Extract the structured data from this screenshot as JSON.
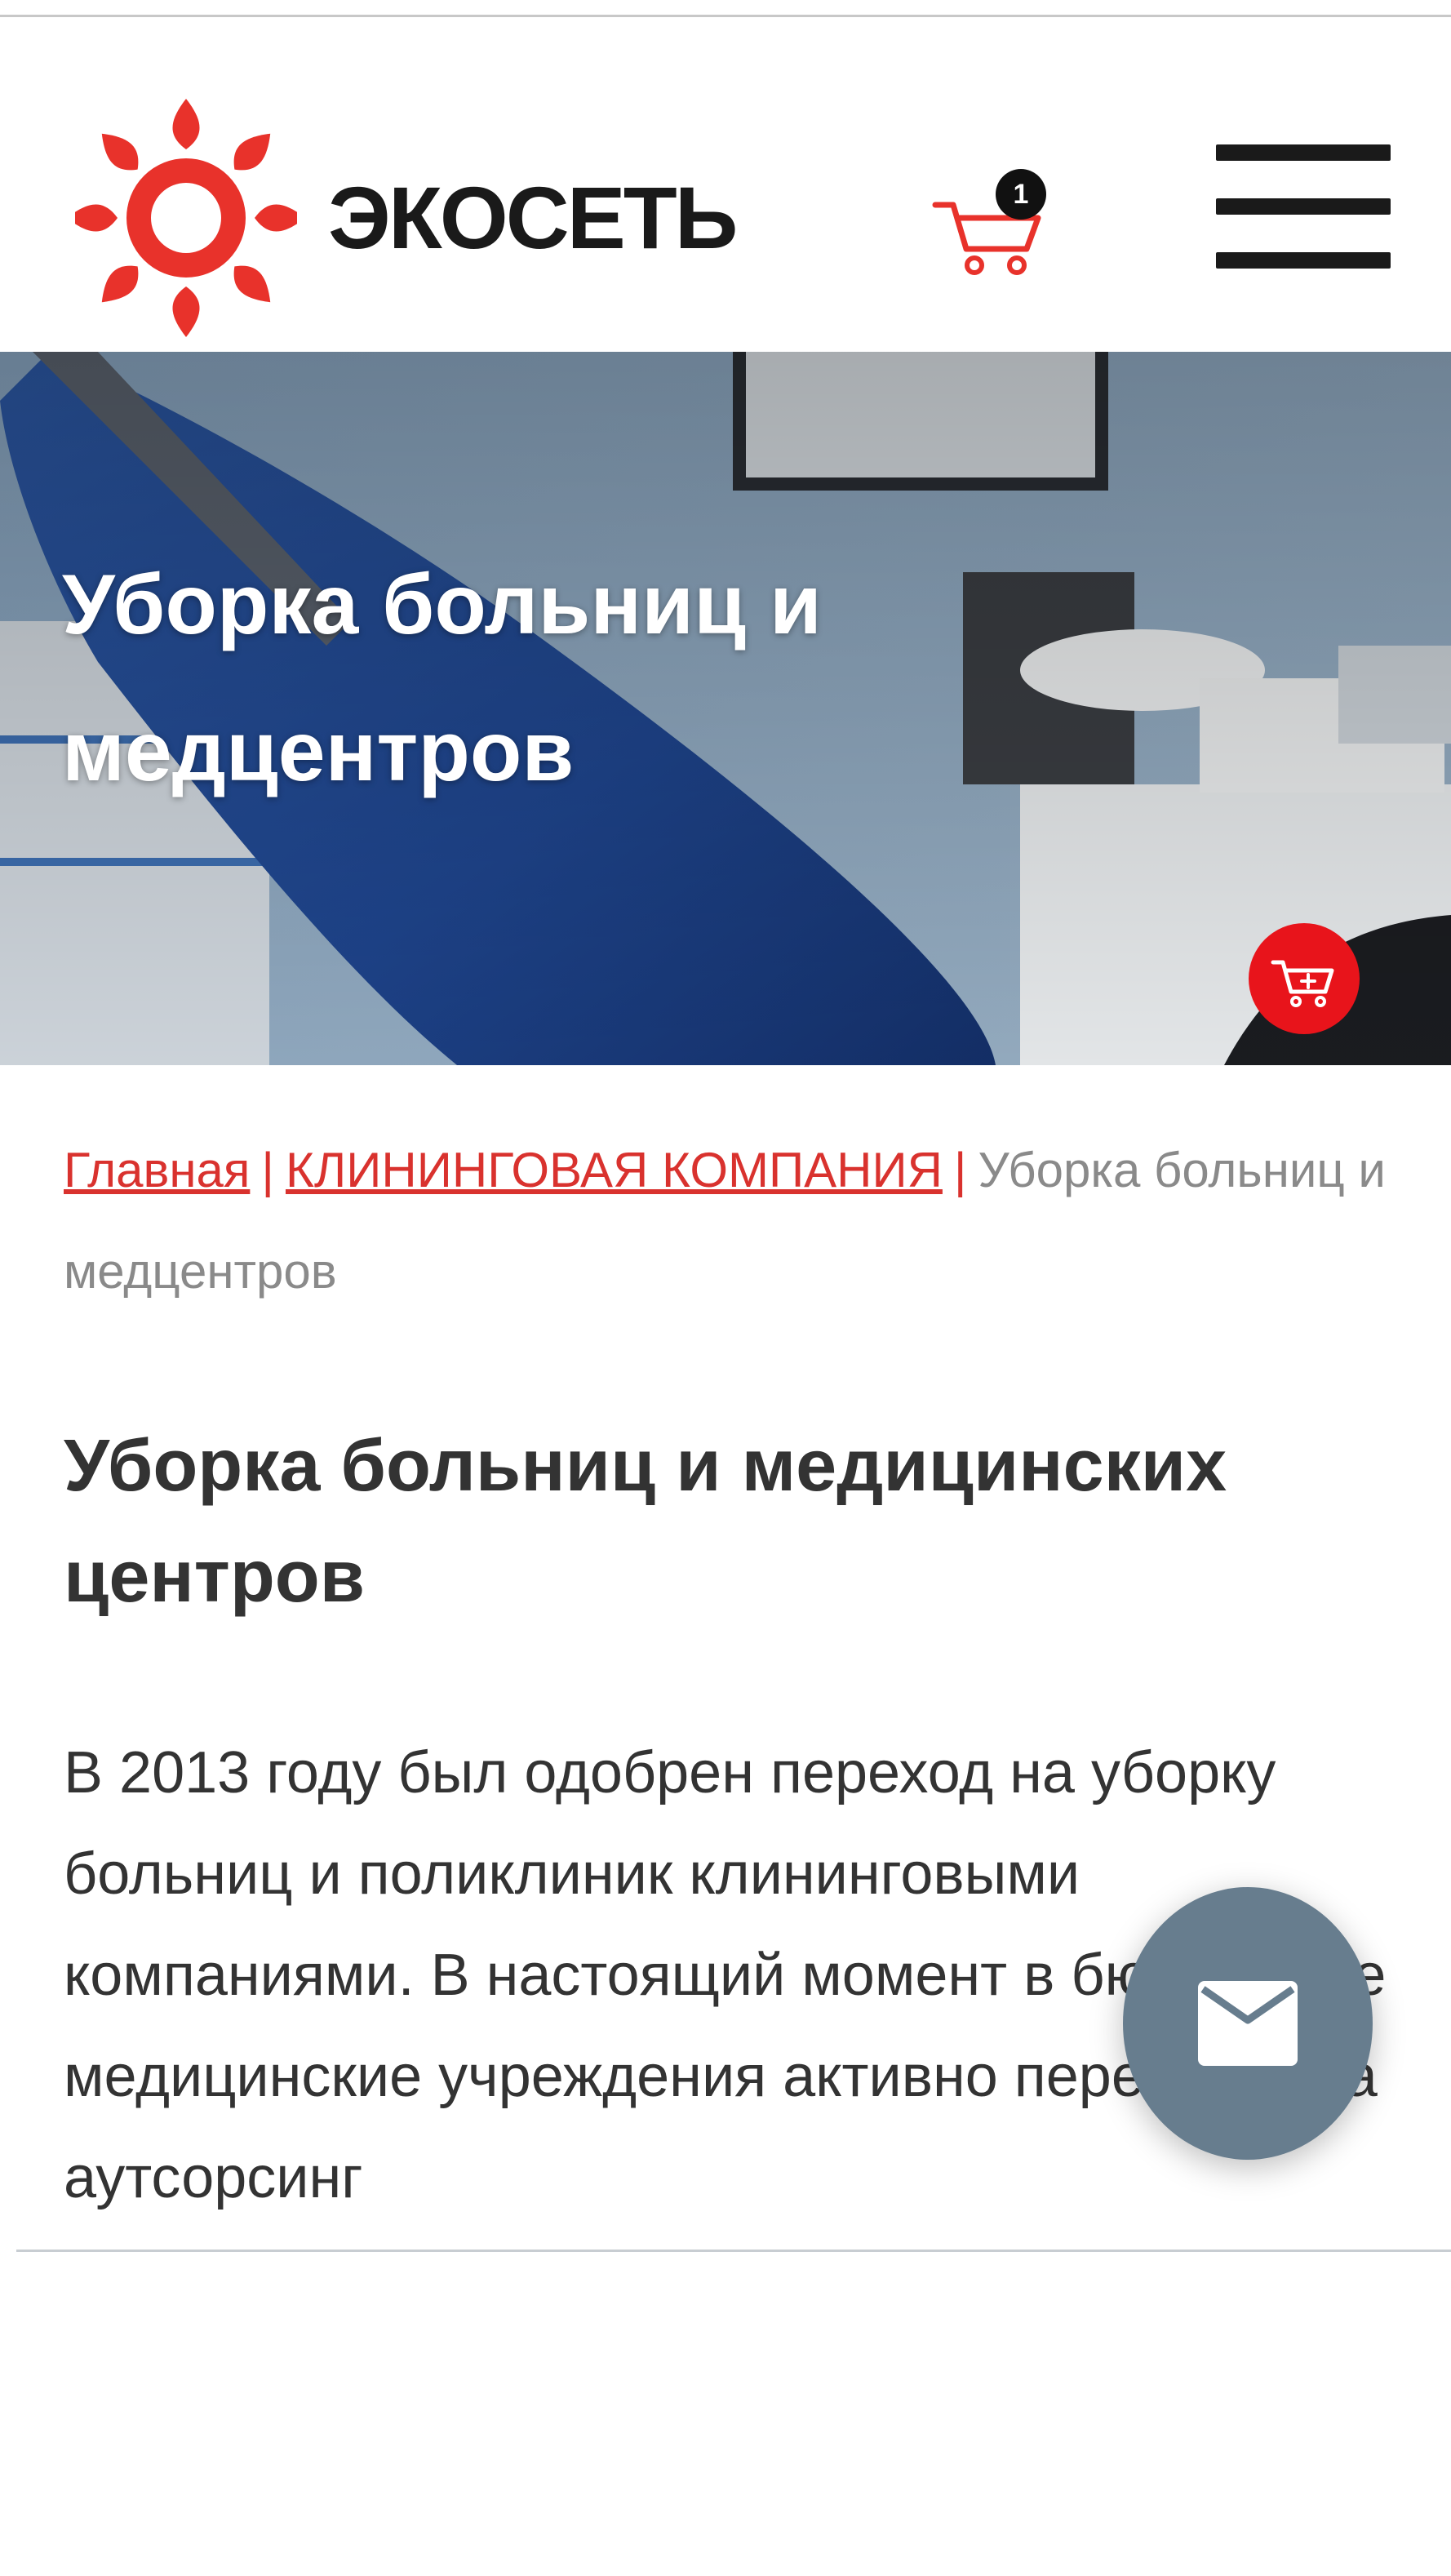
{
  "header": {
    "logo_text": "ЭКОСЕТЬ",
    "logo_color": "#e8322b",
    "cart_count": "1",
    "cart_icon": "cart-icon",
    "menu_icon": "hamburger-menu-icon"
  },
  "hero": {
    "title_line1": "Уборка больниц и",
    "title_line2": "медцентров",
    "add_to_cart_icon": "cart-plus-icon",
    "accent": "#e8141b"
  },
  "breadcrumb": {
    "home": "Главная",
    "section": "КЛИНИНГОВАЯ КОМПАНИЯ",
    "separator": "|",
    "current": "Уборка больниц и медцентров"
  },
  "main": {
    "title": "Уборка больниц и медицинских центров",
    "paragraph": "В 2013 году был одобрен переход на уборку больниц и поликлиник клининговыми компаниями. В настоящий момент в бюджетные медицинские учреждения активно переходят на аутсорсинг"
  },
  "contact_fab": {
    "icon": "mail-icon",
    "color": "#677d8e"
  }
}
